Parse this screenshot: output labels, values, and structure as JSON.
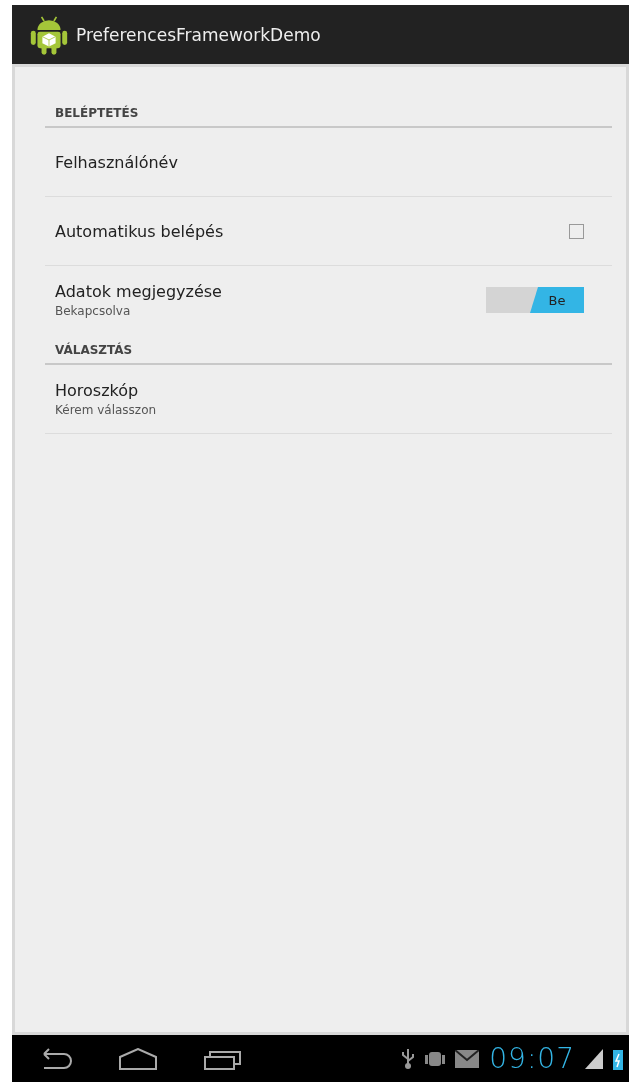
{
  "action_bar": {
    "title": "PreferencesFrameworkDemo"
  },
  "sections": [
    {
      "title": "BELÉPTETÉS",
      "items": [
        {
          "kind": "plain",
          "title": "Felhasználónév"
        },
        {
          "kind": "checkbox",
          "title": "Automatikus belépés",
          "checked": false
        },
        {
          "kind": "switch",
          "title": "Adatok megjegyzése",
          "summary": "Bekapcsolva",
          "on": true,
          "switch_label": "Be"
        }
      ]
    },
    {
      "title": "VÁLASZTÁS",
      "items": [
        {
          "kind": "plain",
          "title": "Horoszkóp",
          "summary": "Kérem válasszon"
        }
      ]
    }
  ],
  "status_bar": {
    "time": "09:07"
  }
}
